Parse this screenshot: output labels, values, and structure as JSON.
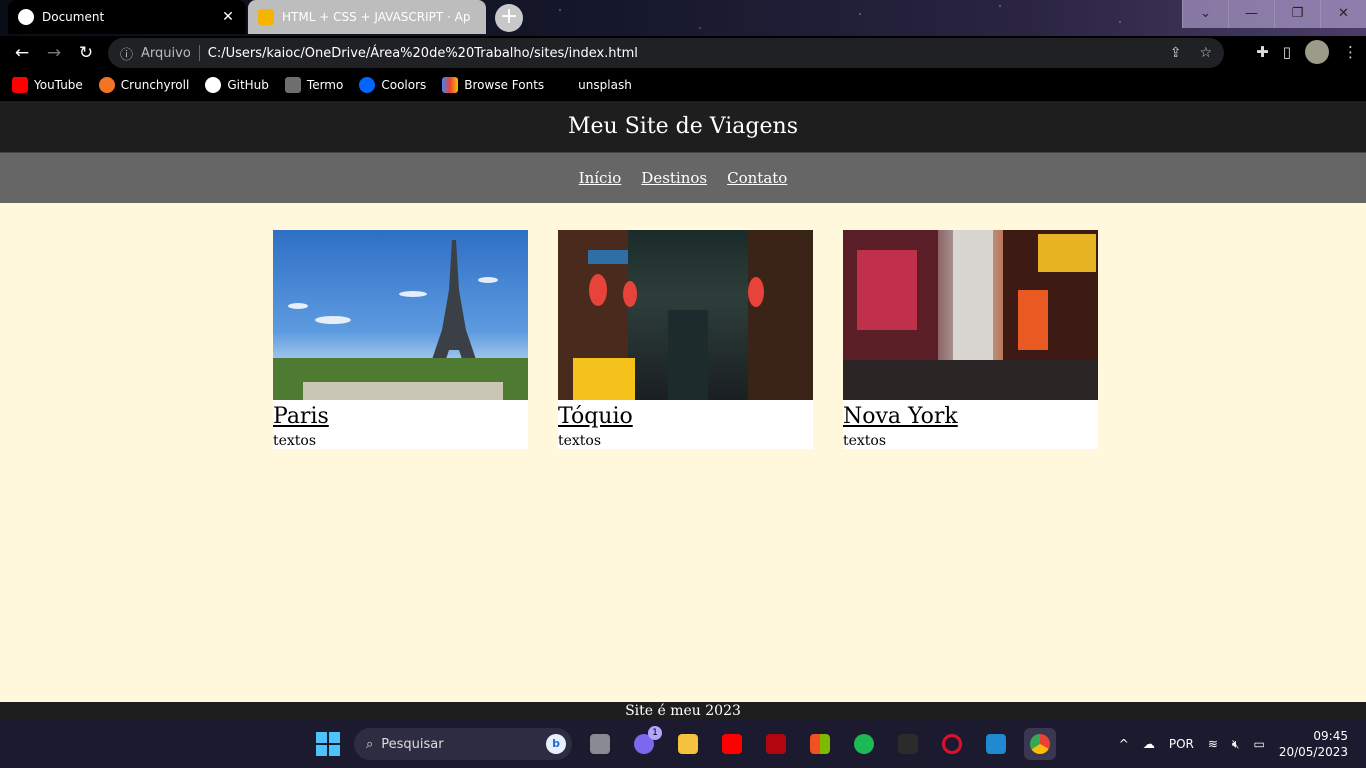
{
  "browser": {
    "tabs": [
      {
        "title": "Document",
        "active": true
      },
      {
        "title": "HTML + CSS + JAVASCRIPT · Ap",
        "active": false
      }
    ],
    "omnibox": {
      "security_label": "Arquivo",
      "url": "C:/Users/kaioc/OneDrive/Área%20de%20Trabalho/sites/index.html"
    },
    "bookmarks": [
      {
        "label": "YouTube",
        "icon": "youtube-icon",
        "color": "#ff0000"
      },
      {
        "label": "Crunchyroll",
        "icon": "crunchyroll-icon",
        "color": "#f47521"
      },
      {
        "label": "GitHub",
        "icon": "github-icon",
        "color": "#ffffff"
      },
      {
        "label": "Termo",
        "icon": "termo-icon",
        "color": "#6e6e6e"
      },
      {
        "label": "Coolors",
        "icon": "coolors-icon",
        "color": "#0066ff"
      },
      {
        "label": "Browse Fonts",
        "icon": "fonts-icon",
        "color": "#4285f4"
      },
      {
        "label": "unsplash",
        "icon": "",
        "color": ""
      }
    ]
  },
  "site": {
    "header_title": "Meu Site de Viagens",
    "nav": [
      "Início",
      "Destinos",
      "Contato"
    ],
    "cards": [
      {
        "name": "Paris",
        "text": "textos",
        "image": "eiffel-tower-photo"
      },
      {
        "name": "Tóquio",
        "text": "textos",
        "image": "tokyo-alley-photo"
      },
      {
        "name": "Nova York",
        "text": "textos",
        "image": "times-square-photo"
      }
    ],
    "footer": "Site é meu 2023",
    "background_color": "#fff8dc"
  },
  "taskbar": {
    "search_placeholder": "Pesquisar",
    "teams_badge": "1",
    "language": "POR",
    "time": "09:45",
    "date": "20/05/2023"
  }
}
